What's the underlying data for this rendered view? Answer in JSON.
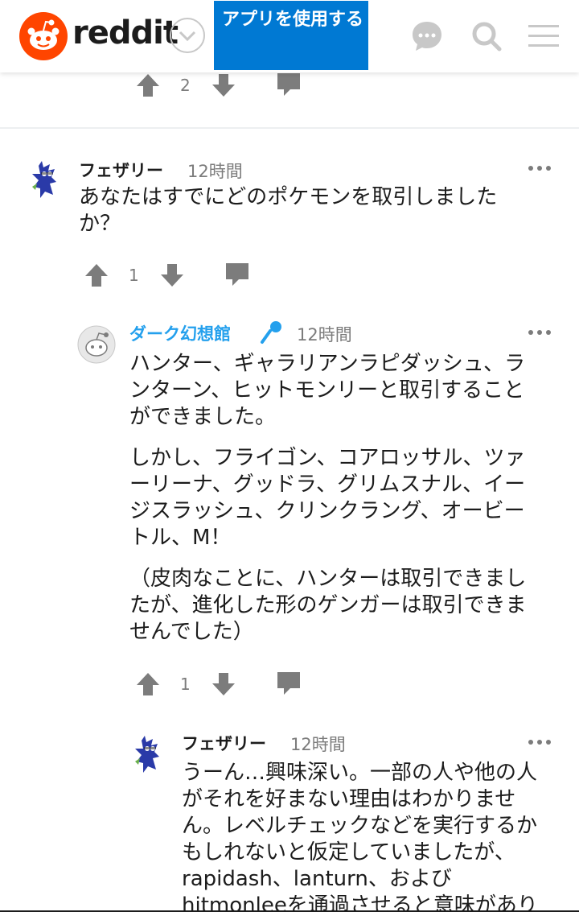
{
  "header": {
    "wordmark": "reddit",
    "app_button_label": "アプリを使用する",
    "icons": [
      "reddit-logo-icon",
      "chevron-down-icon",
      "chat-icon",
      "search-icon",
      "hamburger-menu-icon"
    ]
  },
  "prev_comment": {
    "votes": "2"
  },
  "comments": [
    {
      "author": "フェザリー",
      "time": "12時間",
      "body": [
        "あなたはすでにどのポケモンを取引しました",
        "か？"
      ],
      "votes": "1"
    },
    {
      "author": "ダーク幻想館",
      "time": "12時間",
      "body_paragraphs": [
        "ハンター、ギャラリアンラピダッシュ、ランターン、ヒットモンリーと取引することができました。",
        "しかし、フライゴン、コアロッサル、ツァーリーナ、グッドラ、グリムスナル、イージスラッシュ、クリンクラング、オービートル、M！",
        "（皮肉なことに、ハンターは取引できましたが、進化した形のゲンガーは取引できませんでした）"
      ],
      "votes": "1"
    },
    {
      "author": "フェザリー",
      "time": "12時間",
      "body": "うーん…興味深い。一部の人や他の人がそれを好まない理由はわかりません。レベルチェックなどを実行するかもしれないと仮定していましたが、rapidash、lanturn、およびhitmonleeを通過させると意味がありません。"
    }
  ],
  "colors": {
    "brand": "#ff4500",
    "accent_blue": "#0079d3",
    "mod_link": "#24a0ed",
    "icon_gray": "#7c7c7c"
  }
}
